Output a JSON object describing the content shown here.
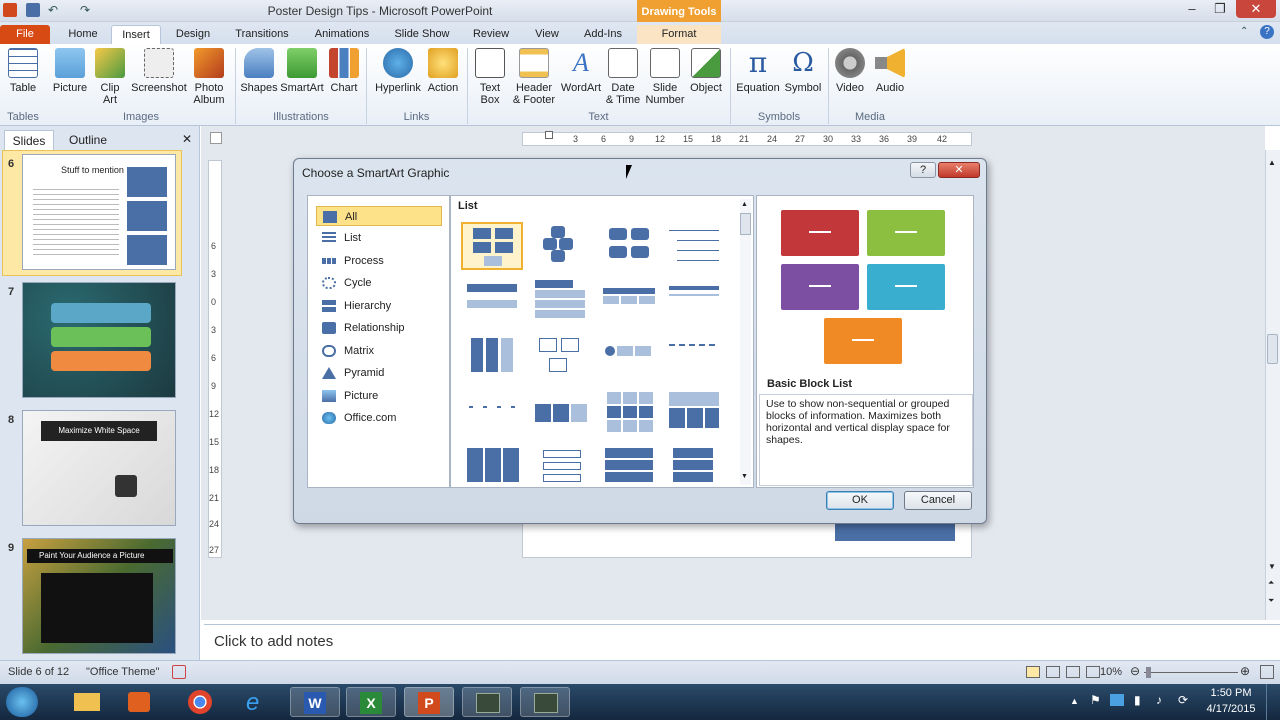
{
  "window": {
    "title": "Poster Design Tips - Microsoft PowerPoint",
    "contextual_group": "Drawing Tools",
    "controls": {
      "minimize": "–",
      "maximize": "❐",
      "close": "✕"
    }
  },
  "tabs": [
    "File",
    "Home",
    "Insert",
    "Design",
    "Transitions",
    "Animations",
    "Slide Show",
    "Review",
    "View",
    "Add-Ins",
    "Format"
  ],
  "active_tab": "Insert",
  "ribbon": {
    "buttons": [
      {
        "label": "Table",
        "icon": "table-icon"
      },
      {
        "label": "Picture",
        "icon": "picture-icon"
      },
      {
        "label": "Clip\nArt",
        "icon": "clip-art-icon"
      },
      {
        "label": "Screenshot",
        "icon": "screenshot-icon"
      },
      {
        "label": "Photo\nAlbum",
        "icon": "photo-album-icon"
      },
      {
        "label": "Shapes",
        "icon": "shapes-icon"
      },
      {
        "label": "SmartArt",
        "icon": "smartart-icon"
      },
      {
        "label": "Chart",
        "icon": "chart-icon"
      },
      {
        "label": "Hyperlink",
        "icon": "hyperlink-icon"
      },
      {
        "label": "Action",
        "icon": "action-icon"
      },
      {
        "label": "Text\nBox",
        "icon": "text-box-icon"
      },
      {
        "label": "Header\n& Footer",
        "icon": "header-footer-icon"
      },
      {
        "label": "WordArt",
        "icon": "wordart-icon"
      },
      {
        "label": "Date\n& Time",
        "icon": "date-time-icon"
      },
      {
        "label": "Slide\nNumber",
        "icon": "slide-number-icon"
      },
      {
        "label": "Object",
        "icon": "object-icon"
      },
      {
        "label": "Equation",
        "icon": "equation-icon"
      },
      {
        "label": "Symbol",
        "icon": "symbol-icon"
      },
      {
        "label": "Video",
        "icon": "video-icon"
      },
      {
        "label": "Audio",
        "icon": "audio-icon"
      }
    ],
    "groups": [
      "Tables",
      "Images",
      "Illustrations",
      "Links",
      "Text",
      "Symbols",
      "Media"
    ]
  },
  "left_pane": {
    "tabs": [
      "Slides",
      "Outline"
    ],
    "close": "✕",
    "slides": [
      {
        "num": "6",
        "title": "Stuff to mention"
      },
      {
        "num": "7",
        "title": ""
      },
      {
        "num": "8",
        "title": "Maximize White Space"
      },
      {
        "num": "9",
        "title": "Paint Your Audience a Picture"
      }
    ]
  },
  "rulers": {
    "top": [
      "3",
      "6",
      "9",
      "12",
      "15",
      "18",
      "21",
      "24",
      "27",
      "30",
      "33",
      "36",
      "39",
      "42"
    ],
    "left": [
      "6",
      "3",
      "0",
      "3",
      "6",
      "9",
      "12",
      "15",
      "18",
      "21",
      "24",
      "27"
    ]
  },
  "dialog": {
    "title": "Choose a SmartArt Graphic",
    "help": "?",
    "close": "✕",
    "categories": [
      {
        "label": "All",
        "icon": "all-icon"
      },
      {
        "label": "List",
        "icon": "list-icon"
      },
      {
        "label": "Process",
        "icon": "process-icon"
      },
      {
        "label": "Cycle",
        "icon": "cycle-icon"
      },
      {
        "label": "Hierarchy",
        "icon": "hierarchy-icon"
      },
      {
        "label": "Relationship",
        "icon": "relationship-icon"
      },
      {
        "label": "Matrix",
        "icon": "matrix-icon"
      },
      {
        "label": "Pyramid",
        "icon": "pyramid-icon"
      },
      {
        "label": "Picture",
        "icon": "picture-category-icon"
      },
      {
        "label": "Office.com",
        "icon": "office-com-icon"
      }
    ],
    "selected_category": "All",
    "grid_heading": "List",
    "preview": {
      "name": "Basic Block List",
      "description": "Use to show non-sequential or grouped blocks of information. Maximizes both horizontal and vertical display space for shapes.",
      "colors": [
        "#c2383a",
        "#8cbf3f",
        "#7d4fa3",
        "#3aaecf",
        "#f08a24"
      ]
    },
    "ok": "OK",
    "cancel": "Cancel"
  },
  "notes": {
    "placeholder": "Click to add notes"
  },
  "status": {
    "slide": "Slide 6 of 12",
    "theme": "\"Office Theme\"",
    "zoom": "10%"
  },
  "taskbar": {
    "time": "1:50 PM",
    "date": "4/17/2015"
  }
}
